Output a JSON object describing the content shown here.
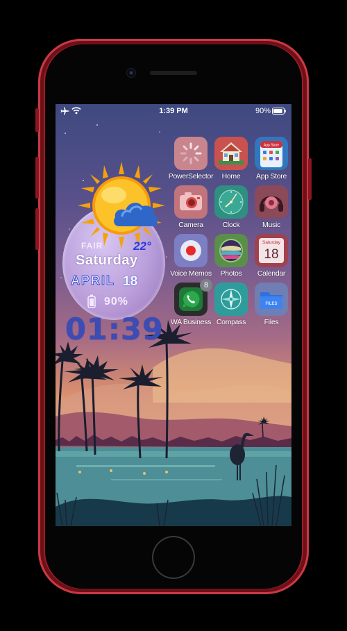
{
  "status_bar": {
    "time": "1:39 PM",
    "battery_percent": "90%",
    "battery_level": 0.9,
    "airplane_mode": true,
    "wifi": true
  },
  "weather_widget": {
    "condition": "FAIR",
    "temperature": "22°",
    "day": "Saturday",
    "month": "APRIL",
    "date": "18",
    "battery": "90%",
    "clock": "01:39",
    "icons": [
      "sun-icon",
      "cloud-icon",
      "battery-icon"
    ]
  },
  "apps": [
    {
      "label": "PowerSelector",
      "icon": "power-selector-icon"
    },
    {
      "label": "Home",
      "icon": "home-icon"
    },
    {
      "label": "App Store",
      "icon": "app-store-icon"
    },
    {
      "label": "Camera",
      "icon": "camera-icon"
    },
    {
      "label": "Clock",
      "icon": "clock-icon"
    },
    {
      "label": "Music",
      "icon": "music-icon"
    },
    {
      "label": "Voice Memos",
      "icon": "voice-memos-icon"
    },
    {
      "label": "Photos",
      "icon": "photos-icon"
    },
    {
      "label": "Calendar",
      "icon": "calendar-icon",
      "weekday": "Saturday",
      "date": "18"
    },
    {
      "label": "WA Business",
      "icon": "whatsapp-business-icon",
      "badge": "8"
    },
    {
      "label": "Compass",
      "icon": "compass-icon"
    },
    {
      "label": "Files",
      "icon": "files-icon",
      "text": "FILES"
    }
  ],
  "icon_artwork_text": {
    "app_store_tile": "App Store"
  },
  "colors": {
    "phone_frame": "#9c1c28",
    "clock_text": "#3b4db5",
    "temperature_text": "#2a3ad8"
  }
}
